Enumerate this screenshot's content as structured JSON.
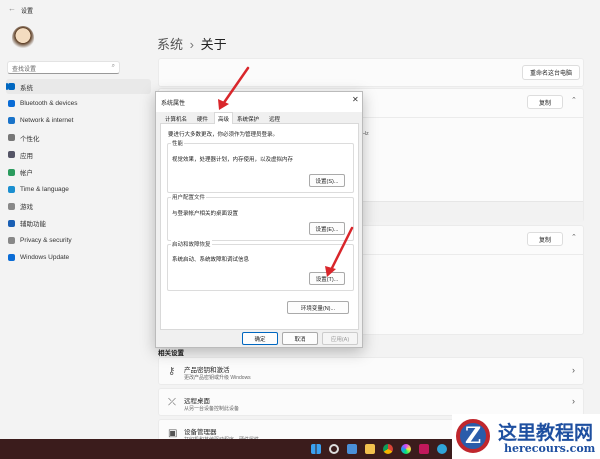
{
  "window": {
    "back_icon": "back-arrow-icon",
    "title": "设置"
  },
  "search": {
    "placeholder": "查找设置"
  },
  "sidebar": {
    "items": [
      {
        "label": "系统",
        "icon": "monitor-icon",
        "color": "#0067c0"
      },
      {
        "label": "Bluetooth & devices",
        "icon": "bluetooth-icon",
        "color": "#0a6cd6"
      },
      {
        "label": "Network & internet",
        "icon": "wifi-icon",
        "color": "#1a73c9"
      },
      {
        "label": "个性化",
        "icon": "brush-icon",
        "color": "#777"
      },
      {
        "label": "应用",
        "icon": "apps-icon",
        "color": "#556"
      },
      {
        "label": "帐户",
        "icon": "account-icon",
        "color": "#2b9b5e"
      },
      {
        "label": "Time & language",
        "icon": "globe-clock-icon",
        "color": "#1b8fd0"
      },
      {
        "label": "游戏",
        "icon": "gamepad-icon",
        "color": "#888"
      },
      {
        "label": "辅助功能",
        "icon": "accessibility-icon",
        "color": "#1a5fb4"
      },
      {
        "label": "Privacy & security",
        "icon": "shield-icon",
        "color": "#888"
      },
      {
        "label": "Windows Update",
        "icon": "update-icon",
        "color": "#0a6cd6"
      }
    ]
  },
  "main": {
    "breadcrumb_parent": "系统",
    "breadcrumb_sep": "›",
    "breadcrumb_current": "关于",
    "rename_button": "重命名这台电脑",
    "copy_button": "复制",
    "copy_button2": "复制",
    "hz_text": "Hz",
    "related_title": "相关设置",
    "related": [
      {
        "title": "产品密钥和激活",
        "subtitle": "更改产品密钥或升级 Windows",
        "icon": "key-icon"
      },
      {
        "title": "远程桌面",
        "subtitle": "从另一台设备控制此设备",
        "icon": "remote-desktop-icon"
      },
      {
        "title": "设备管理器",
        "subtitle": "打印机和其他驱动程序、硬件属性",
        "icon": "device-manager-icon"
      }
    ]
  },
  "dialog": {
    "title": "系统属性",
    "tabs": [
      "计算机名",
      "硬件",
      "高级",
      "系统保护",
      "远程"
    ],
    "active_tab": "高级",
    "admin_note": "要进行大多数更改，你必须作为管理员登录。",
    "groups": [
      {
        "label": "性能",
        "desc": "视觉效果，处理器计划，内存使用，以及虚拟内存",
        "button": "设置(S)..."
      },
      {
        "label": "用户配置文件",
        "desc": "与登录帐户相关的桌面设置",
        "button": "设置(E)..."
      },
      {
        "label": "启动和故障恢复",
        "desc": "系统启动、系统故障和调试信息",
        "button": "设置(T)..."
      }
    ],
    "env_button": "环境变量(N)...",
    "ok": "确定",
    "cancel": "取消",
    "apply": "应用(A)"
  },
  "watermark": {
    "name": "这里教程网",
    "url": "herecours.com"
  },
  "colors": {
    "accent": "#0067c0",
    "arrow": "#d9262b",
    "taskbar": "#3b1c1c"
  }
}
